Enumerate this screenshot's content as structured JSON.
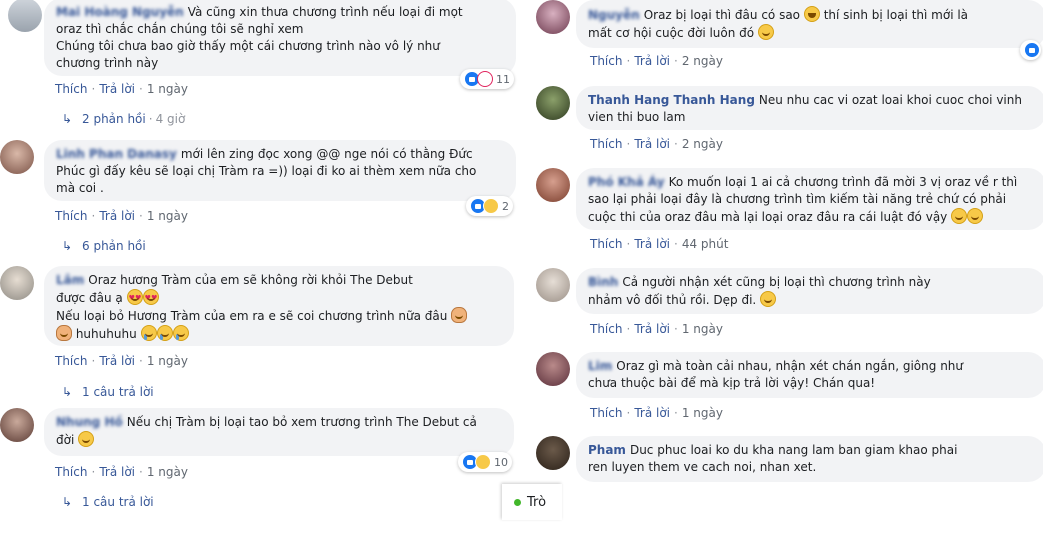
{
  "left_comments": [
    {
      "author": "Mai Hoàng Nguyễn",
      "text_lines": [
        "Và cũng xin thưa chương trình nếu loại đi mọt",
        "oraz thì chắc chắn chúng tôi sẽ nghỉ xem",
        "Chúng tôi chưa bao giờ thấy một cái chương trình nào vô lý như",
        "chương trình này"
      ],
      "reaction_count": "11",
      "like": "Thích",
      "reply": "Trả lời",
      "time": "1 ngày",
      "replies_label": "2 phản hồi",
      "replies_time": "4 giờ"
    },
    {
      "author": "Linh Phan Danasy",
      "text_lines": [
        "mới lên zing đọc xong @@ nge nói có thằng Đức",
        "Phúc gì đấy kêu sẽ loại chị Tràm ra =)) loại đi ko ai thèm xem nữa cho",
        "mà coi ."
      ],
      "reaction_count": "2",
      "like": "Thích",
      "reply": "Trả lời",
      "time": "1 ngày",
      "replies_label": "6 phản hồi"
    },
    {
      "author": "Lâm",
      "text_lines": [
        "Oraz hương Tràm của em sẽ không rời khỏi The Debut",
        "được đâu ạ",
        "Nếu loại bỏ Hương Tràm của em ra e sẽ coi chương trình nữa đâu",
        "huhuhuhu"
      ],
      "like": "Thích",
      "reply": "Trả lời",
      "time": "1 ngày",
      "replies_label": "1 câu trả lời"
    },
    {
      "author": "Nhung Hồ",
      "text_lines": [
        "Nếu chị Tràm bị loại tao bỏ xem trương trình The Debut cả",
        "đời"
      ],
      "reaction_count": "10",
      "like": "Thích",
      "reply": "Trả lời",
      "time": "1 ngày",
      "replies_label": "1 câu trả lời"
    }
  ],
  "right_comments": [
    {
      "author": "Nguyễn",
      "text_lines": [
        "Oraz bị loại thì đâu có sao",
        "thí sinh bị loại thì mới là",
        "mất cơ hội cuộc đời luôn đó"
      ],
      "like": "Thích",
      "reply": "Trả lời",
      "time": "2 ngày"
    },
    {
      "author": "Thanh Hang Thanh Hang",
      "text_lines": [
        "Neu nhu cac vi ozat loai khoi cuoc choi vinh",
        "vien thi buo lam"
      ],
      "like": "Thích",
      "reply": "Trả lời",
      "time": "2 ngày"
    },
    {
      "author": "Phó Khả Áy",
      "text_lines": [
        "Ko muốn loại 1 ai cả chương trình đã mời 3 vị oraz về r thì",
        "sao lại phải loại đây là chương trình tìm kiếm tài năng trẻ chứ có phải",
        "cuộc thi của oraz đâu mà lại loại oraz đâu ra cái luật đó vậy"
      ],
      "like": "Thích",
      "reply": "Trả lời",
      "time": "44 phút"
    },
    {
      "author": "Bình",
      "text_lines": [
        "Cả người nhận xét cũng bị loại thì chương trình này",
        "nhảm vô đối thủ rồi. Dẹp đi."
      ],
      "like": "Thích",
      "reply": "Trả lời",
      "time": "1 ngày"
    },
    {
      "author": "Lim",
      "text_lines": [
        "Oraz gì mà toàn cải nhau, nhận xét chán ngắn, giông như",
        "chưa thuộc bài để mà kịp trả lời vậy! Chán qua!"
      ],
      "like": "Thích",
      "reply": "Trả lời",
      "time": "1 ngày"
    },
    {
      "author": "Pham",
      "text_lines": [
        "Duc phuc loai ko du kha nang lam ban giam khao phai",
        "ren luyen them ve cach noi, nhan xet."
      ]
    }
  ],
  "chat": {
    "label": "Trò"
  },
  "colors": {
    "link": "#385898",
    "bubble": "#f2f3f5",
    "meta": "#606770",
    "online": "#42b72a"
  }
}
